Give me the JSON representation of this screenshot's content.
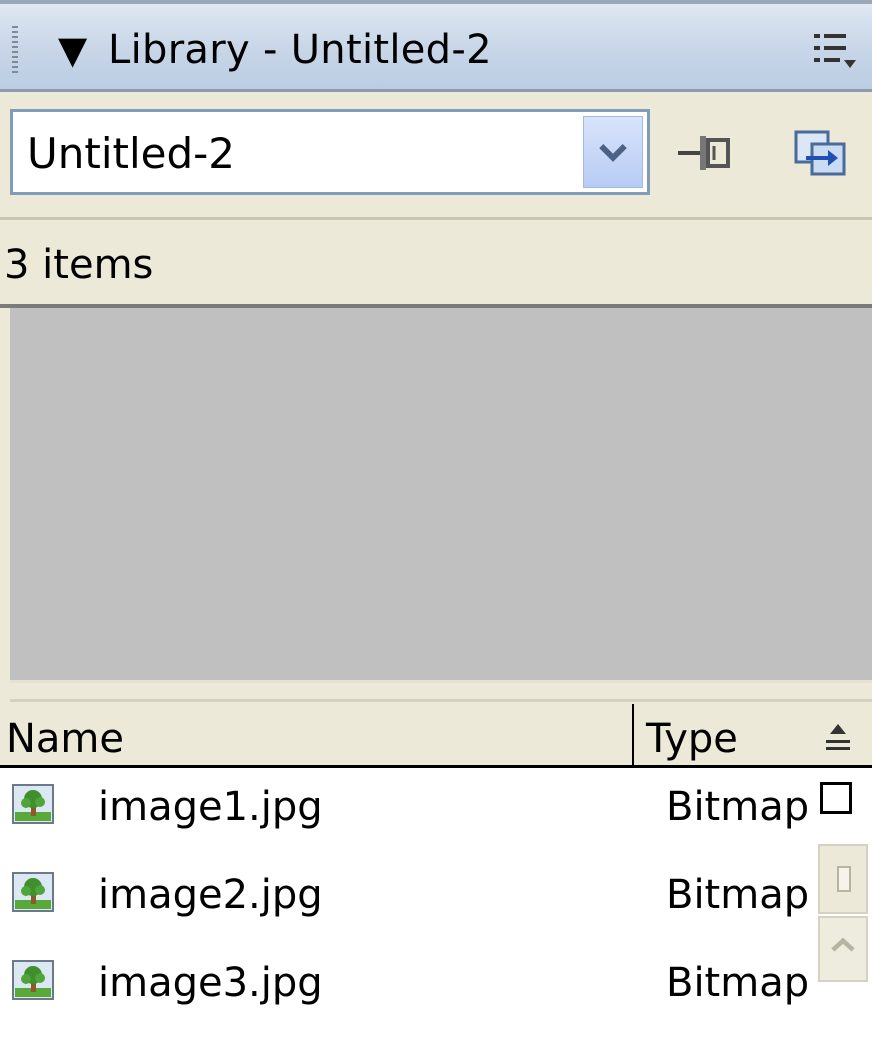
{
  "panel": {
    "title": "Library - Untitled-2",
    "collapse_glyph": "▼",
    "menu_icon": "options-menu-icon"
  },
  "toolbar": {
    "document_select": {
      "value": "Untitled-2",
      "dropdown_icon": "chevron-down-icon"
    },
    "pin_icon": "pin-library-icon",
    "new_library_icon": "new-library-panel-icon"
  },
  "status": {
    "item_count_text": "3 items"
  },
  "list": {
    "columns": [
      {
        "label": "Name"
      },
      {
        "label": "Type"
      }
    ],
    "sort_icon": "sort-order-icon",
    "items": [
      {
        "name": "image1.jpg",
        "type": "Bitmap",
        "icon": "bitmap-icon"
      },
      {
        "name": "image2.jpg",
        "type": "Bitmap",
        "icon": "bitmap-icon"
      },
      {
        "name": "image3.jpg",
        "type": "Bitmap",
        "icon": "bitmap-icon"
      }
    ]
  },
  "colors": {
    "titlebar": "#c7d5e7",
    "panel_bg": "#ece9d8",
    "preview_bg": "#c0c0c0",
    "combo_border": "#7f9db9"
  }
}
